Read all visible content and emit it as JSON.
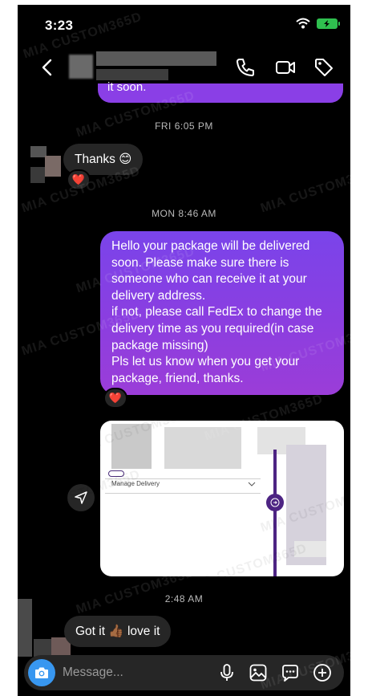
{
  "status_bar": {
    "time": "3:23"
  },
  "header": {
    "icons": [
      "back-icon",
      "phone-icon",
      "video-icon",
      "tag-icon"
    ]
  },
  "messages": {
    "prev_fragment": "it soon.",
    "ts_fri": "FRI 6:05 PM",
    "thanks_text": "Thanks 😊",
    "thanks_reaction": "❤️",
    "ts_mon": "MON 8:46 AM",
    "outgoing_text": "Hello your package will be delivered soon. Please make sure there is someone who can receive it at your delivery address.\nif not, please call FedEx to change the delivery time as you required(in case package missing)\nPls let us know when you get your package, friend, thanks.",
    "outgoing_reaction": "❤️",
    "image_label": "Manage Delivery",
    "ts_248": "2:48 AM",
    "reply_text": "Got it 👍🏾 love it"
  },
  "composer": {
    "placeholder": "Message..."
  },
  "watermark": "MIA CUSTOM365D",
  "colors": {
    "outgoing_bubble": "#8a3fe6",
    "incoming_bubble": "#262626",
    "camera_button": "#3897f0",
    "reaction_heart": "#ef2d4b"
  }
}
